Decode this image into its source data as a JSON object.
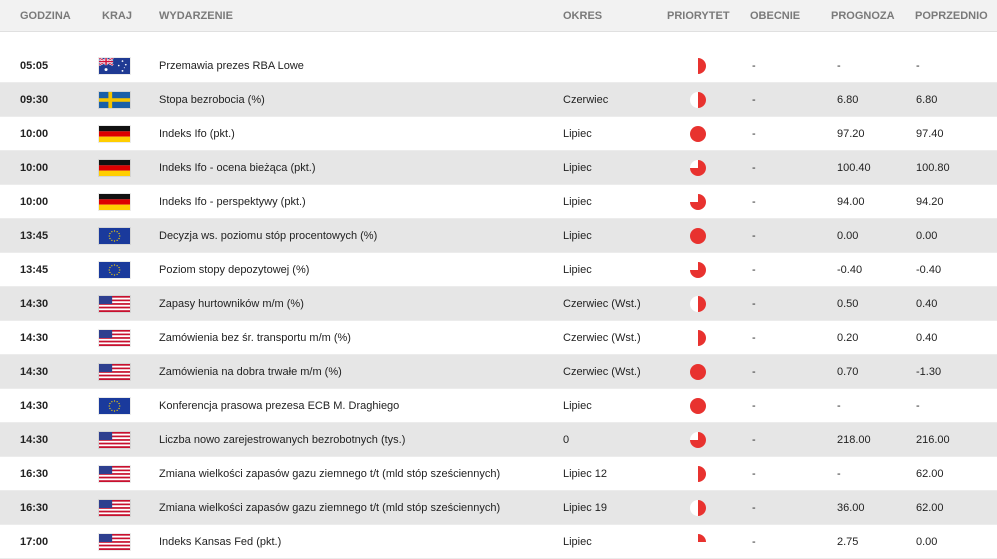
{
  "columns": {
    "time": "GODZINA",
    "country": "KRAJ",
    "event": "WYDARZENIE",
    "period": "OKRES",
    "priority": "PRIORYTET",
    "actual": "OBECNIE",
    "forecast": "PROGNOZA",
    "previous": "POPRZEDNIO"
  },
  "colors": {
    "priority_red": "#e8322f",
    "header_bg": "#f2f2f2",
    "row_alt_bg": "#e6e6e6"
  },
  "rows": [
    {
      "time": "05:05",
      "flag": "au-flag-icon",
      "event": "Przemawia prezes RBA Lowe",
      "period": "",
      "priority_level": 0.5,
      "actual": "-",
      "forecast": "-",
      "previous": "-"
    },
    {
      "time": "09:30",
      "flag": "se-flag-icon",
      "event": "Stopa bezrobocia (%)",
      "period": "Czerwiec",
      "priority_level": 0.5,
      "actual": "-",
      "forecast": "6.80",
      "previous": "6.80"
    },
    {
      "time": "10:00",
      "flag": "de-flag-icon",
      "event": "Indeks Ifo (pkt.)",
      "period": "Lipiec",
      "priority_level": 1,
      "actual": "-",
      "forecast": "97.20",
      "previous": "97.40"
    },
    {
      "time": "10:00",
      "flag": "de-flag-icon",
      "event": "Indeks Ifo - ocena bieżąca (pkt.)",
      "period": "Lipiec",
      "priority_level": 0.75,
      "actual": "-",
      "forecast": "100.40",
      "previous": "100.80"
    },
    {
      "time": "10:00",
      "flag": "de-flag-icon",
      "event": "Indeks Ifo - perspektywy (pkt.)",
      "period": "Lipiec",
      "priority_level": 0.75,
      "actual": "-",
      "forecast": "94.00",
      "previous": "94.20"
    },
    {
      "time": "13:45",
      "flag": "eu-flag-icon",
      "event": "Decyzja ws. poziomu stóp procentowych (%)",
      "period": "Lipiec",
      "priority_level": 1,
      "actual": "-",
      "forecast": "0.00",
      "previous": "0.00"
    },
    {
      "time": "13:45",
      "flag": "eu-flag-icon",
      "event": "Poziom stopy depozytowej (%)",
      "period": "Lipiec",
      "priority_level": 0.75,
      "actual": "-",
      "forecast": "-0.40",
      "previous": "-0.40"
    },
    {
      "time": "14:30",
      "flag": "us-flag-icon",
      "event": "Zapasy hurtowników m/m (%)",
      "period": "Czerwiec (Wst.)",
      "priority_level": 0.5,
      "actual": "-",
      "forecast": "0.50",
      "previous": "0.40"
    },
    {
      "time": "14:30",
      "flag": "us-flag-icon",
      "event": "Zamówienia bez śr. transportu m/m (%)",
      "period": "Czerwiec (Wst.)",
      "priority_level": 0.5,
      "actual": "-",
      "forecast": "0.20",
      "previous": "0.40"
    },
    {
      "time": "14:30",
      "flag": "us-flag-icon",
      "event": "Zamówienia na dobra trwałe m/m (%)",
      "period": "Czerwiec (Wst.)",
      "priority_level": 1,
      "actual": "-",
      "forecast": "0.70",
      "previous": "-1.30"
    },
    {
      "time": "14:30",
      "flag": "eu-flag-icon",
      "event": "Konferencja prasowa prezesa ECB M. Draghiego",
      "period": "Lipiec",
      "priority_level": 1,
      "actual": "-",
      "forecast": "-",
      "previous": "-"
    },
    {
      "time": "14:30",
      "flag": "us-flag-icon",
      "event": "Liczba nowo zarejestrowanych bezrobotnych (tys.)",
      "period": "0",
      "priority_level": 0.75,
      "actual": "-",
      "forecast": "218.00",
      "previous": "216.00"
    },
    {
      "time": "16:30",
      "flag": "us-flag-icon",
      "event": "Zmiana wielkości zapasów gazu ziemnego t/t (mld stóp sześciennych)",
      "period": "Lipiec 12",
      "priority_level": 0.5,
      "actual": "-",
      "forecast": "-",
      "previous": "62.00"
    },
    {
      "time": "16:30",
      "flag": "us-flag-icon",
      "event": "Zmiana wielkości zapasów gazu ziemnego t/t (mld stóp sześciennych)",
      "period": "Lipiec 19",
      "priority_level": 0.5,
      "actual": "-",
      "forecast": "36.00",
      "previous": "62.00"
    },
    {
      "time": "17:00",
      "flag": "us-flag-icon",
      "event": "Indeks Kansas Fed (pkt.)",
      "period": "Lipiec",
      "priority_level": 0.25,
      "actual": "-",
      "forecast": "2.75",
      "previous": "0.00"
    }
  ]
}
